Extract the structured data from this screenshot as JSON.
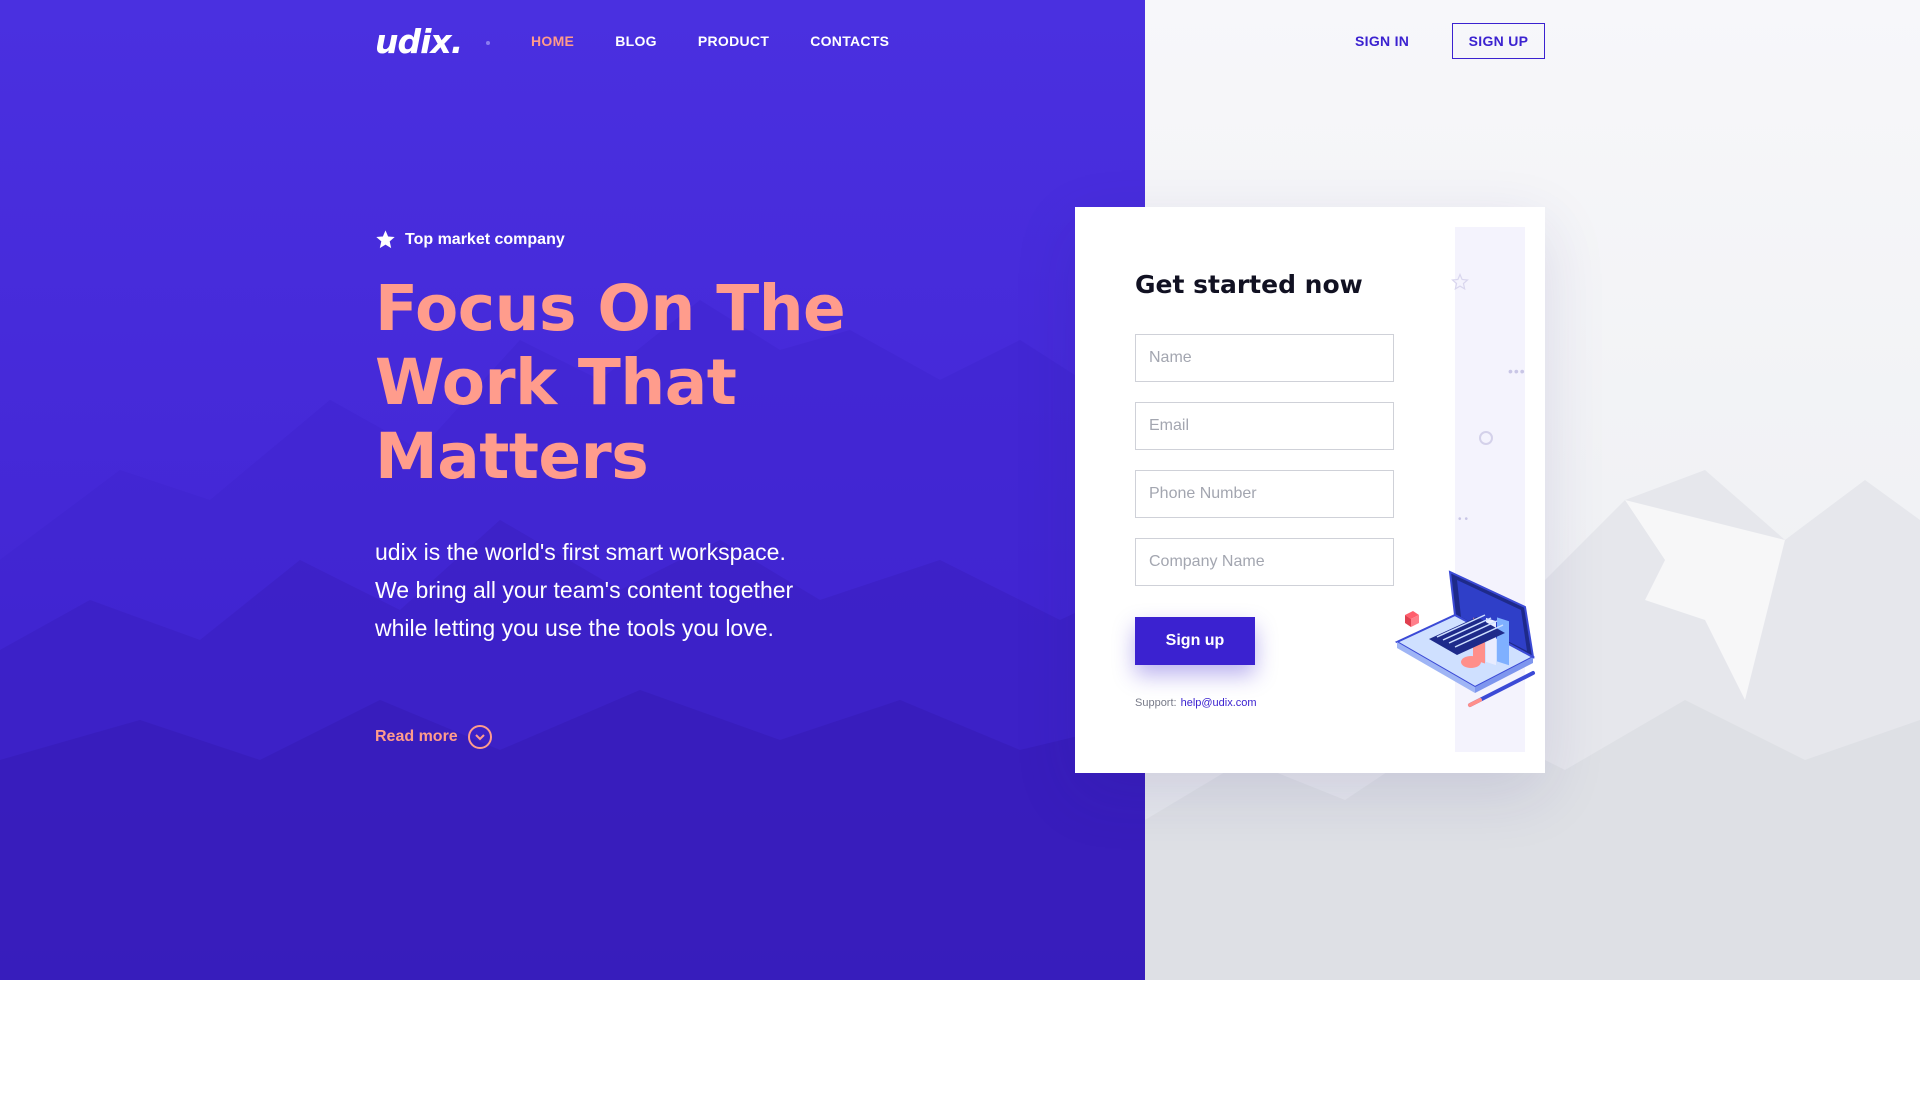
{
  "nav": {
    "logo": "udix.",
    "items": [
      {
        "label": "HOME",
        "active": true
      },
      {
        "label": "BLOG",
        "active": false
      },
      {
        "label": "PRODUCT",
        "active": false
      },
      {
        "label": "CONTACTS",
        "active": false
      }
    ],
    "sign_in": "SIGN IN",
    "sign_up": "SIGN UP"
  },
  "hero": {
    "badge": "Top market company",
    "headline_lines": [
      "Focus On The",
      "Work That",
      "Matters"
    ],
    "description_lines": [
      "udix is the world's first smart workspace.",
      "We bring all your team's content together",
      "while letting you use the tools you love."
    ],
    "read_more": "Read more"
  },
  "form": {
    "title": "Get started now",
    "fields": [
      {
        "placeholder": "Name",
        "value": ""
      },
      {
        "placeholder": "Email",
        "value": ""
      },
      {
        "placeholder": "Phone Number",
        "value": ""
      },
      {
        "placeholder": "Company Name",
        "value": ""
      }
    ],
    "submit": "Sign up",
    "support_label": "Support:",
    "support_email": "help@udix.com"
  },
  "colors": {
    "brand": "#3b22d0",
    "accent": "#ff9c8c",
    "hero_bg": "#4529d8"
  },
  "icons": [
    "star-icon",
    "chevron-down-circle-icon",
    "laptop-illustration"
  ]
}
